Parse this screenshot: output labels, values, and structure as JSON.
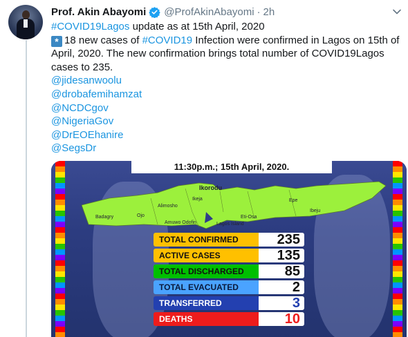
{
  "tweet": {
    "display_name": "Prof. Akin Abayomi",
    "handle": "@ProfAkinAbayomi",
    "separator": "·",
    "time": "2h",
    "line1_hashtag": "#COVID19Lagos",
    "line1_rest": " update  as at 15th April, 2020",
    "line2_emoji": "*",
    "line2_pre": "18 new cases of ",
    "line2_hashtag": "#COVID19",
    "line2_post": " Infection were confirmed in Lagos on 15th of April, 2020. The new confirmation brings total number of COVID19Lagos cases to 235.",
    "mentions": [
      "@jidesanwoolu",
      "@drobafemihamzat",
      "@NCDCgov",
      "@NigeriaGov",
      "@DrEOEhanire",
      "@SegsDr"
    ]
  },
  "media": {
    "banner": "11:30p.m.; 15th April, 2020.",
    "map_labels": {
      "ikorodu": "Ikorodu",
      "epe": "Epe",
      "ibeju": "Ibeju",
      "badagry": "Badagry",
      "ojo": "Ojo",
      "ikeja": "Ikeja",
      "eti_osa": "Eti-Osa",
      "lagos_island": "Lagos Island",
      "amuwo": "Amuwo Odofin",
      "alimosho": "Alimosho"
    },
    "stats": [
      {
        "label": "TOTAL CONFIRMED",
        "value": "235",
        "color": "#ffc000",
        "text_color": "#111111"
      },
      {
        "label": "ACTIVE CASES",
        "value": "135",
        "color": "#ffc000",
        "text_color": "#111111"
      },
      {
        "label": "TOTAL DISCHARGED",
        "value": "85",
        "color": "#00c000",
        "text_color": "#111111"
      },
      {
        "label": "TOTAL EVACUATED",
        "value": "2",
        "color": "#4aa3ff",
        "text_color": "#0a1a3a"
      },
      {
        "label": "TRANSFERRED",
        "value": "3",
        "color": "#2340b0",
        "text_color": "#ffffff"
      },
      {
        "label": "DEATHS",
        "value": "10",
        "color": "#ee1c1c",
        "text_color": "#ffffff"
      }
    ]
  },
  "colors": {
    "link": "#1b95e0",
    "secondary_text": "#657786",
    "verified": "#1da1f2",
    "map_fill": "#9cf03c"
  },
  "icons": {
    "verified": "verified-badge-icon",
    "caret": "chevron-down-icon",
    "emoji": "asterisk-emoji-icon"
  }
}
